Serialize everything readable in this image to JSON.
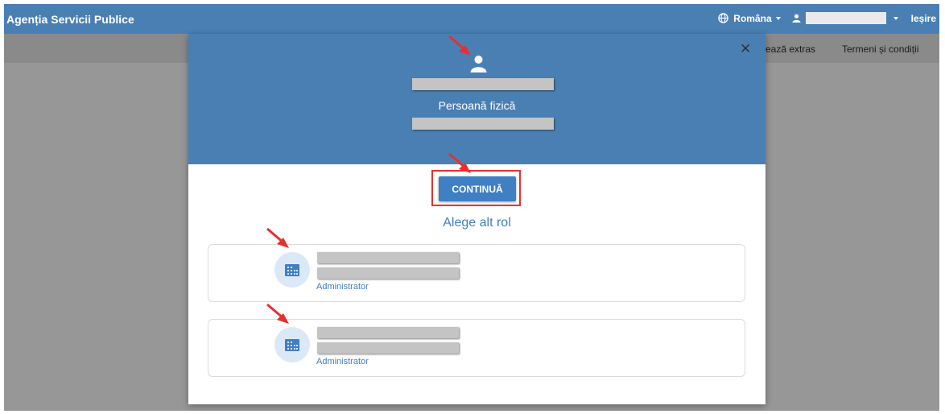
{
  "app": {
    "title": "Agenția Servicii Publice"
  },
  "header": {
    "language": "Româna",
    "logout": "Ieșire"
  },
  "subnav": {
    "link1": "ează extras",
    "link2": "Termeni și condiții"
  },
  "modal": {
    "close_icon": "close-icon",
    "person_type": "Persoană fizică",
    "continue_label": "CONTINUĂ",
    "alternate_role_title": "Alege alt rol",
    "roles": [
      {
        "label": "Administrator",
        "icon": "building-icon"
      },
      {
        "label": "Administrator",
        "icon": "building-icon"
      }
    ]
  },
  "colors": {
    "primary": "#4a7fb4",
    "button": "#3f7fc3",
    "annotation": "#e63030",
    "overlay": "#979797"
  }
}
